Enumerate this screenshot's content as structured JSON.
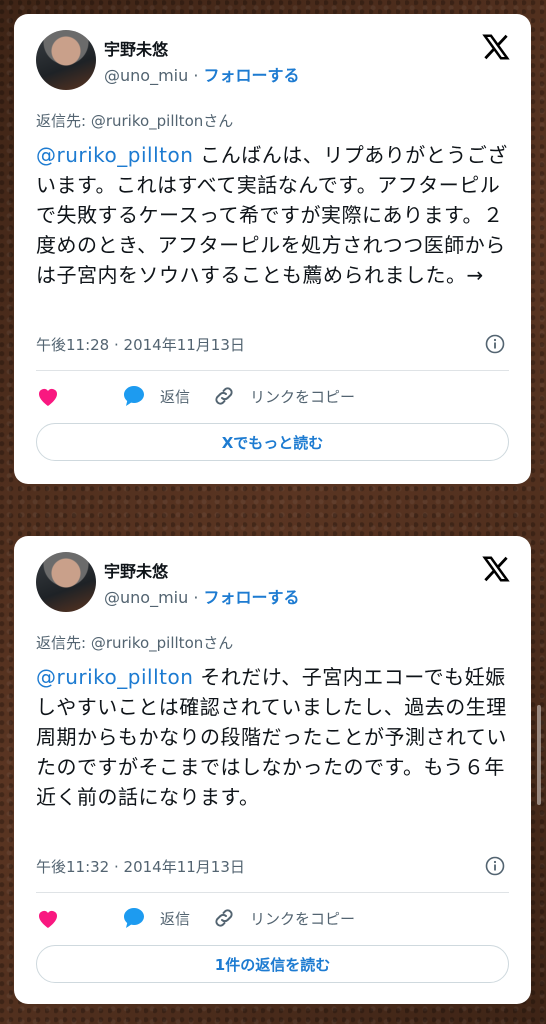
{
  "tweets": [
    {
      "author_name": "宇野未悠",
      "handle": "@uno_miu",
      "separator": " · ",
      "follow_label": "フォローする",
      "reply_to": "返信先: @ruriko_pilltonさん",
      "mention": "@ruriko_pillton",
      "body": " こんばんは、リプありがとうございます。これはすべて実話なんです。アフターピルで失敗するケースって希ですが実際にあります。２度めのとき、アフターピルを処方されつつ医師からは子宮内をソウハすることも薦められました。→",
      "timestamp": "午後11:28 · 2014年11月13日",
      "reply_label": "返信",
      "copy_link_label": "リンクをコピー",
      "read_more_label": "Xでもっと読む"
    },
    {
      "author_name": "宇野未悠",
      "handle": "@uno_miu",
      "separator": " · ",
      "follow_label": "フォローする",
      "reply_to": "返信先: @ruriko_pilltonさん",
      "mention": "@ruriko_pillton",
      "body": " それだけ、子宮内エコーでも妊娠しやすいことは確認されていましたし、過去の生理周期からもかなりの段階だったことが予測されていたのですがそこまではしなかったのです。もう６年近く前の話になります。",
      "timestamp": "午後11:32 · 2014年11月13日",
      "reply_label": "返信",
      "copy_link_label": "リンクをコピー",
      "read_more_label": "1件の返信を読む"
    }
  ],
  "colors": {
    "like": "#f91880",
    "reply": "#1d9bf0",
    "link": "#1d7bd1",
    "muted": "#536471"
  },
  "icons": [
    "x-logo-icon",
    "info-icon",
    "heart-icon",
    "reply-bubble-icon",
    "link-icon"
  ]
}
